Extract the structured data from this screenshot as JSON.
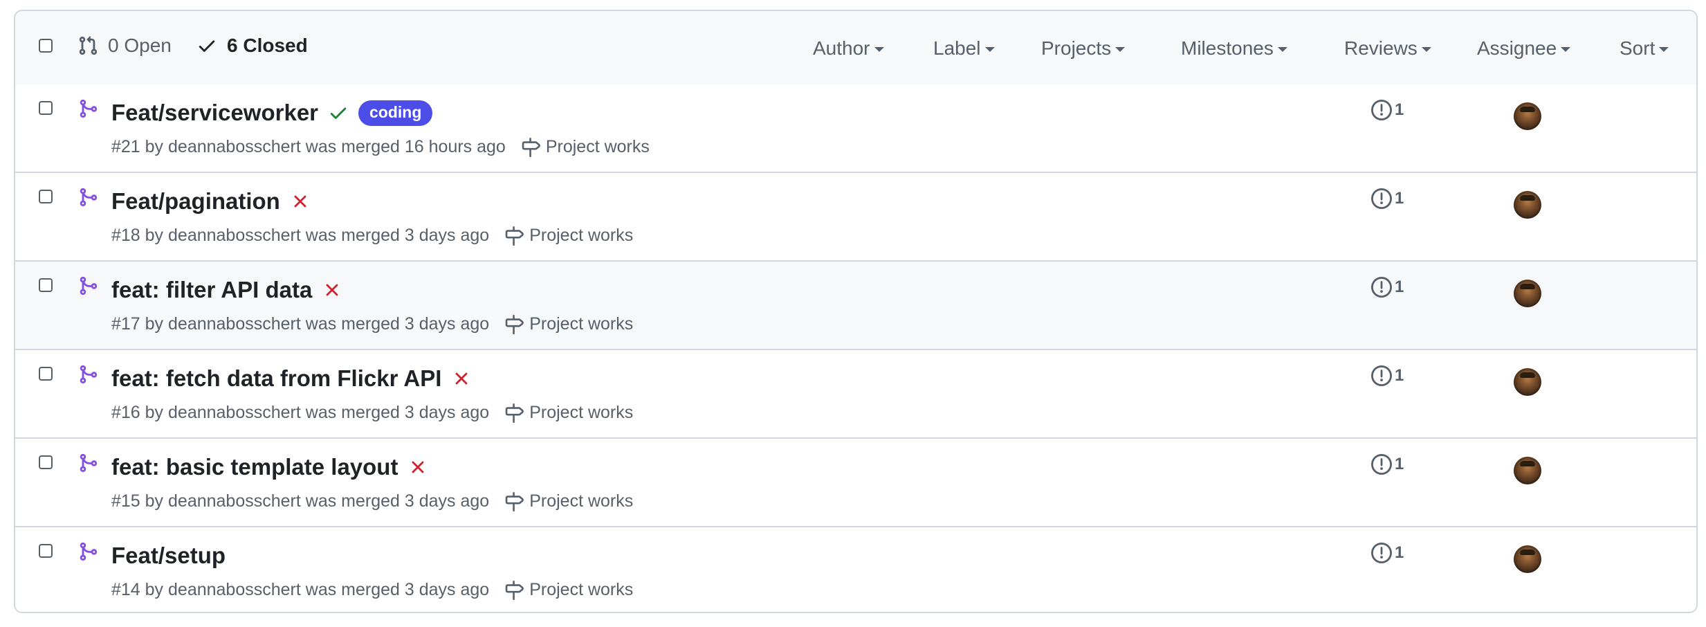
{
  "header": {
    "open_label": "0 Open",
    "closed_label": "6 Closed",
    "filters": [
      "Author",
      "Label",
      "Projects",
      "Milestones",
      "Reviews",
      "Assignee",
      "Sort"
    ]
  },
  "colors": {
    "merged_purple": "#8250df",
    "success_green": "#1a7f37",
    "failure_red": "#cf222e",
    "label_coding": "#4c4ce6",
    "border": "#d0d7de"
  },
  "pull_requests": [
    {
      "title": "Feat/serviceworker",
      "status": "success",
      "label": "coding",
      "meta": "#21 by deannabosschert was merged 16 hours ago",
      "milestone": "Project works",
      "issues": "1"
    },
    {
      "title": "Feat/pagination",
      "status": "failure",
      "label": "",
      "meta": "#18 by deannabosschert was merged 3 days ago",
      "milestone": "Project works",
      "issues": "1"
    },
    {
      "title": "feat: filter API data",
      "status": "failure",
      "label": "",
      "meta": "#17 by deannabosschert was merged 3 days ago",
      "milestone": "Project works",
      "issues": "1"
    },
    {
      "title": "feat: fetch data from Flickr API",
      "status": "failure",
      "label": "",
      "meta": "#16 by deannabosschert was merged 3 days ago",
      "milestone": "Project works",
      "issues": "1"
    },
    {
      "title": "feat: basic template layout",
      "status": "failure",
      "label": "",
      "meta": "#15 by deannabosschert was merged 3 days ago",
      "milestone": "Project works",
      "issues": "1"
    },
    {
      "title": "Feat/setup",
      "status": "none",
      "label": "",
      "meta": "#14 by deannabosschert was merged 3 days ago",
      "milestone": "Project works",
      "issues": "1"
    }
  ]
}
